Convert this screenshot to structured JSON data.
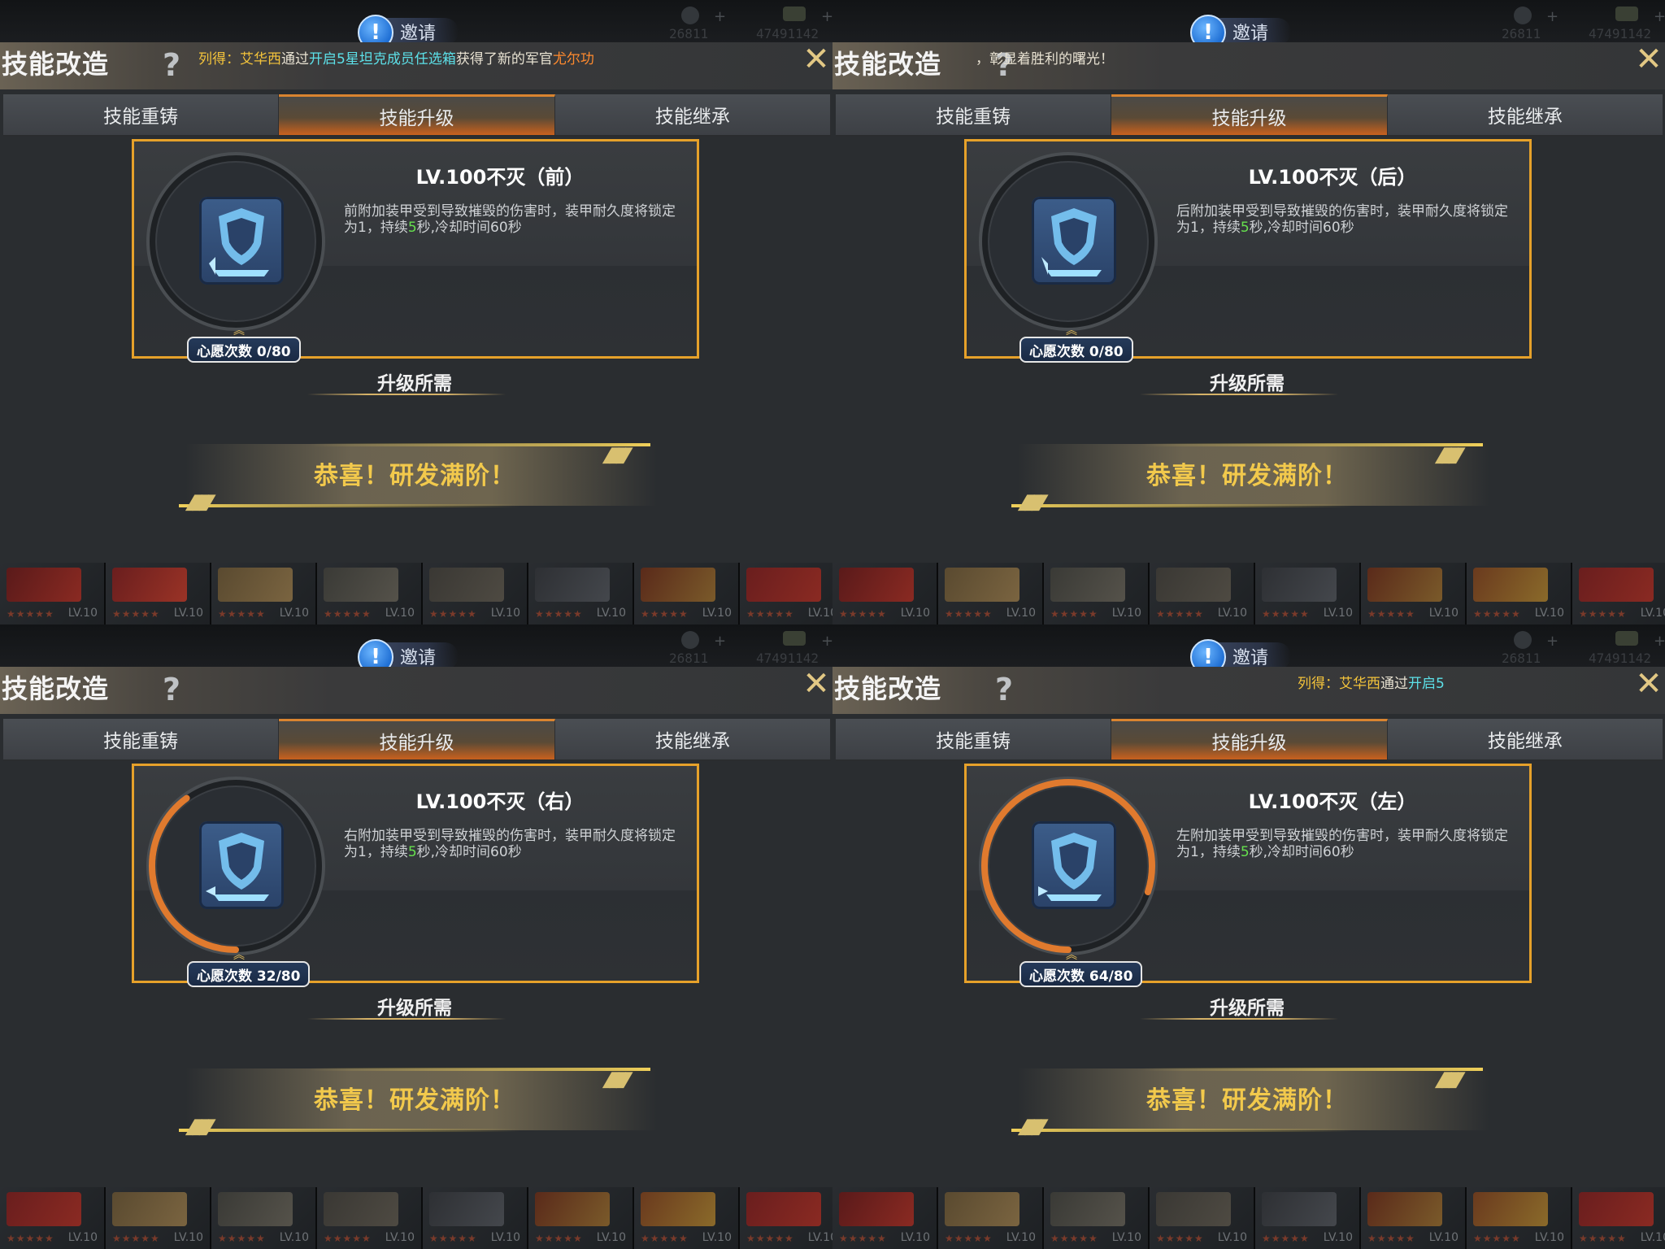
{
  "hud": {
    "left_value": "26811",
    "right_value": "47491142"
  },
  "invite_label": "邀请",
  "window_title": "技能改造",
  "help_glyph": "?",
  "close_glyph": "✕",
  "tabs": [
    "技能重铸",
    "技能升级",
    "技能继承"
  ],
  "active_tab": "技能升级",
  "requirement_label": "升级所需",
  "congrats_text": "恭喜！研发满阶！",
  "inventory_level": "LV.10",
  "inventory_stars": "★★★★★",
  "panels": [
    {
      "skill_title": "LV.100不灭（前）",
      "desc_before": "前附加装甲受到导致摧毁的伤害时，装甲耐久度将锁定为1，持续",
      "desc_highlight": "5",
      "desc_after": "秒,冷却时间60秒",
      "wish_count": "心愿次数 0/80",
      "progress": 0,
      "ticker": {
        "a": "列得：",
        "b": "艾华西",
        "c": "通过",
        "d": "开启5星坦克成员任选箱",
        "e": "获得了新的军官",
        "f": "尤尔功"
      }
    },
    {
      "skill_title": "LV.100不灭（后）",
      "desc_before": "后附加装甲受到导致摧毁的伤害时，装甲耐久度将锁定为1，持续",
      "desc_highlight": "5",
      "desc_after": "秒,冷却时间60秒",
      "wish_count": "心愿次数 0/80",
      "progress": 0,
      "ticker": {
        "a": "，彰显着胜利的曙光！"
      }
    },
    {
      "skill_title": "LV.100不灭（右）",
      "desc_before": "右附加装甲受到导致摧毁的伤害时，装甲耐久度将锁定为1，持续",
      "desc_highlight": "5",
      "desc_after": "秒,冷却时间60秒",
      "wish_count": "心愿次数 32/80",
      "progress": 0.4
    },
    {
      "skill_title": "LV.100不灭（左）",
      "desc_before": "左附加装甲受到导致摧毁的伤害时，装甲耐久度将锁定为1，持续",
      "desc_highlight": "5",
      "desc_after": "秒,冷却时间60秒",
      "wish_count": "心愿次数 64/80",
      "progress": 0.8,
      "ticker": {
        "a": "列得：",
        "b": "艾华西",
        "c": "通过",
        "d": "开启5"
      }
    }
  ],
  "colors": {
    "accent": "#e6a12a",
    "progress": "#e07a2e",
    "highlight": "#66e04e",
    "gold_text": "#f2c94c"
  }
}
